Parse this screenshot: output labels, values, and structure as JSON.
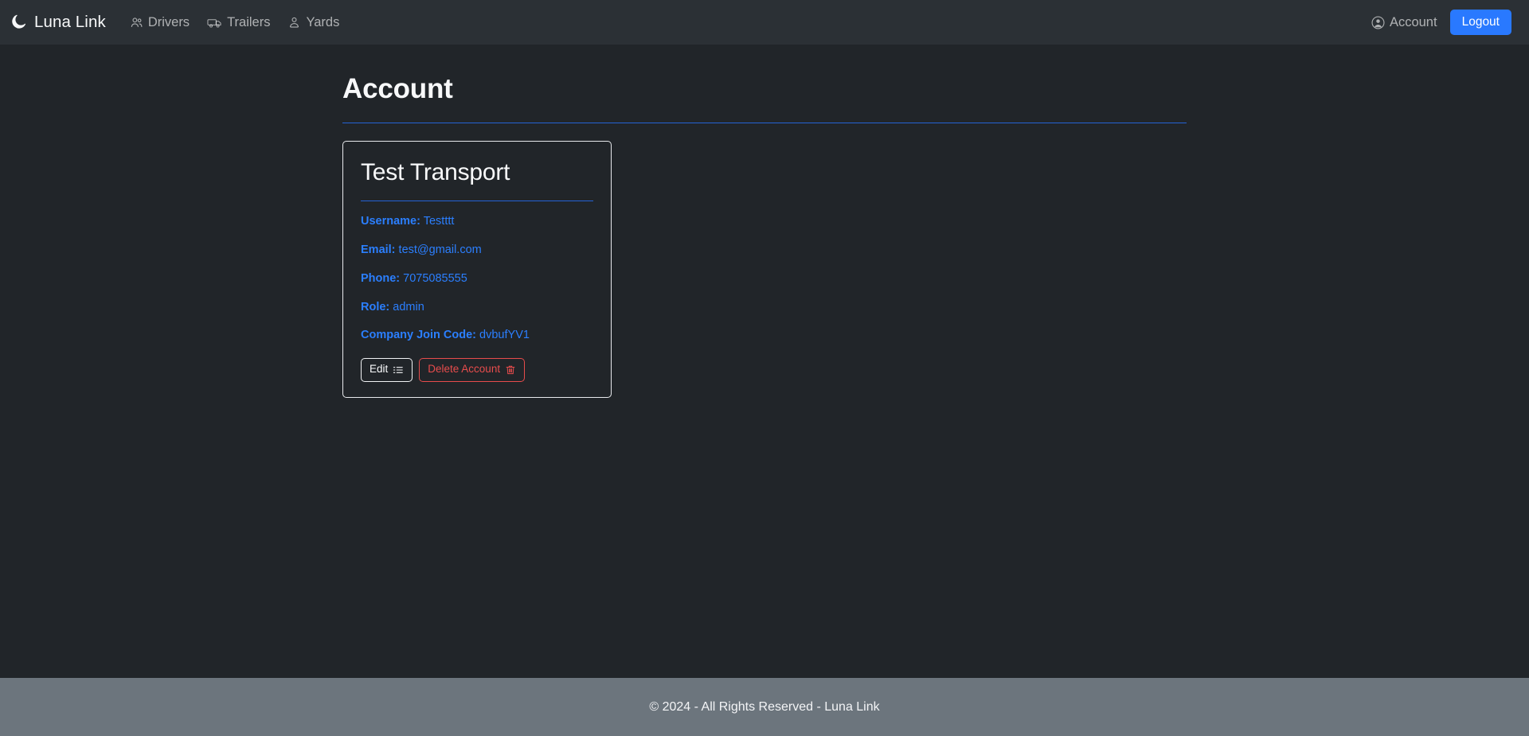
{
  "navbar": {
    "brand": "Luna Link",
    "brand_icon": "moon-icon",
    "links": [
      {
        "label": "Drivers",
        "icon": "people-icon"
      },
      {
        "label": "Trailers",
        "icon": "trailer-truck-icon"
      },
      {
        "label": "Yards",
        "icon": "person-pin-icon"
      }
    ],
    "account_label": "Account",
    "account_icon": "user-circle-icon",
    "logout_label": "Logout",
    "logout_color": "#2979ff"
  },
  "page": {
    "title": "Account"
  },
  "card": {
    "title": "Test Transport",
    "details": [
      {
        "label": "Username:",
        "value": "Testttt"
      },
      {
        "label": "Email:",
        "value": "test@gmail.com"
      },
      {
        "label": "Phone:",
        "value": "7075085555"
      },
      {
        "label": "Role:",
        "value": "admin"
      },
      {
        "label": "Company Join Code:",
        "value": "dvbufYV1"
      }
    ],
    "detail_color": "#2b7fff",
    "edit_label": "Edit",
    "edit_icon": "list-icon",
    "delete_label": "Delete Account",
    "delete_icon": "trash-icon",
    "delete_color": "#e74c4c"
  },
  "footer": {
    "text": "© 2024 - All Rights Reserved - Luna Link"
  }
}
